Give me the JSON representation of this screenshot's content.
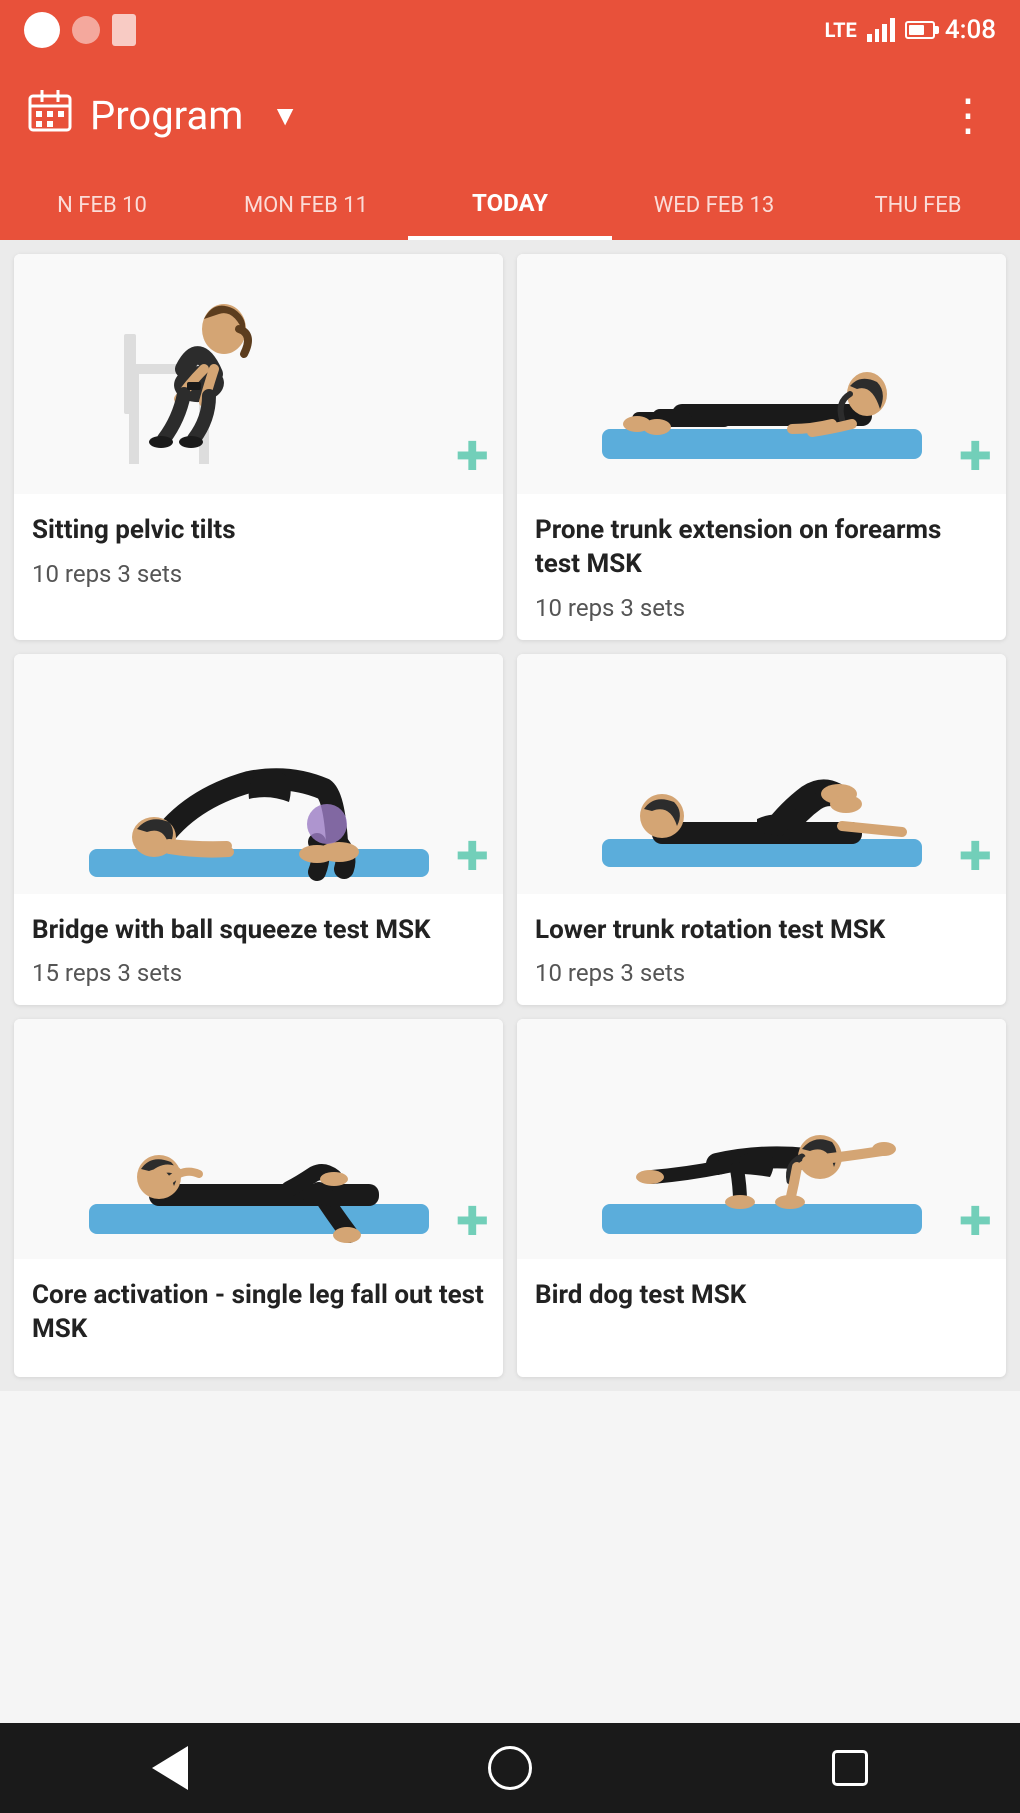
{
  "statusBar": {
    "time": "4:08",
    "lte": "LTE"
  },
  "appBar": {
    "title": "Program",
    "moreIcon": "⋮"
  },
  "dateTabs": [
    {
      "label": "N FEB 10",
      "active": false
    },
    {
      "label": "MON FEB 11",
      "active": false
    },
    {
      "label": "TODAY",
      "active": true
    },
    {
      "label": "WED FEB 13",
      "active": false
    },
    {
      "label": "THU FEB",
      "active": false
    }
  ],
  "exercises": [
    {
      "title": "Sitting pelvic tilts",
      "reps": "10 reps 3 sets",
      "type": "sitting"
    },
    {
      "title": "Prone trunk extension on forearms test MSK",
      "reps": "10 reps 3 sets",
      "type": "prone-forearms"
    },
    {
      "title": "Bridge with ball squeeze test MSK",
      "reps": "15 reps 3 sets",
      "type": "bridge"
    },
    {
      "title": "Lower trunk rotation test MSK",
      "reps": "10 reps 3 sets",
      "type": "lower-rotation"
    },
    {
      "title": "Core activation - single leg fall out test MSK",
      "reps": "",
      "type": "core-activation"
    },
    {
      "title": "Bird dog test MSK",
      "reps": "",
      "type": "bird-dog"
    }
  ],
  "addIcon": "✚",
  "nav": {
    "back": "◀",
    "home": "○",
    "square": "□"
  }
}
